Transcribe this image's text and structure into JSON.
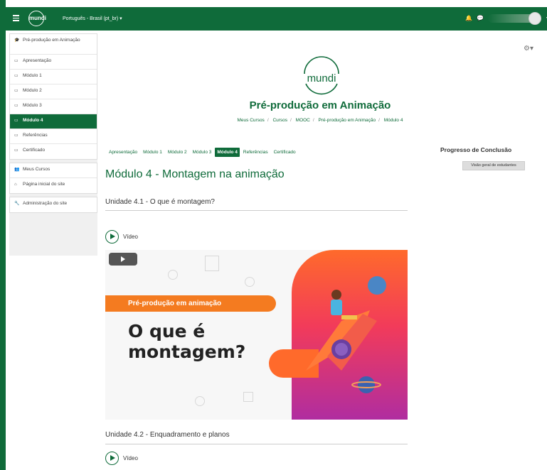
{
  "topbar": {
    "logo_text": "mundi",
    "language": "Português - Brasil (pt_br) ▾",
    "caret": "▾"
  },
  "sidebar": {
    "groups": [
      [
        {
          "icon": "graduation-cap-icon",
          "label": "Pré-produção em Animação",
          "active": false
        },
        {
          "icon": "folder-icon",
          "label": "Apresentação",
          "active": false
        },
        {
          "icon": "folder-icon",
          "label": "Módulo 1",
          "active": false
        },
        {
          "icon": "folder-icon",
          "label": "Módulo 2",
          "active": false
        },
        {
          "icon": "folder-icon",
          "label": "Módulo 3",
          "active": false
        },
        {
          "icon": "folder-icon",
          "label": "Módulo 4",
          "active": true
        },
        {
          "icon": "folder-icon",
          "label": "Referências",
          "active": false
        },
        {
          "icon": "folder-icon",
          "label": "Certificado",
          "active": false
        }
      ],
      [
        {
          "icon": "users-icon",
          "label": "Meus Cursos",
          "active": false
        },
        {
          "icon": "home-icon",
          "label": "Página inicial do site",
          "active": false
        }
      ],
      [
        {
          "icon": "wrench-icon",
          "label": "Administração do site",
          "active": false
        }
      ]
    ]
  },
  "header": {
    "brand": "mundi",
    "course_title": "Pré-produção em Animação",
    "breadcrumb": [
      "Meus Cursos",
      "Cursos",
      "MOOC",
      "Pré-produção em Animação",
      "Módulo 4"
    ]
  },
  "tabs": [
    {
      "label": "Apresentação",
      "active": false
    },
    {
      "label": "Módulo 1",
      "active": false
    },
    {
      "label": "Módulo 2",
      "active": false
    },
    {
      "label": "Módulo 3",
      "active": false
    },
    {
      "label": "Módulo 4",
      "active": true
    },
    {
      "label": "Referências",
      "active": false
    },
    {
      "label": "Certificado",
      "active": false
    }
  ],
  "main": {
    "section_title": "Módulo 4 - Montagem na animação",
    "unit1_title": "Unidade 4.1 - O que é montagem?",
    "unit1_video": "Vídeo",
    "thumbnail": {
      "banner": "Pré-produção em animação",
      "headline_line1": "O que é",
      "headline_line2": "montagem?"
    },
    "unit2_title": "Unidade 4.2 - Enquadramento e planos",
    "unit2_video": "Vídeo"
  },
  "progress_panel": {
    "title": "Progresso de Conclusão",
    "button": "Visão geral de estudantes"
  },
  "colors": {
    "brand_green": "#0f6b3a",
    "accent_orange": "#f47b20",
    "accent_pink": "#f23b5a"
  }
}
